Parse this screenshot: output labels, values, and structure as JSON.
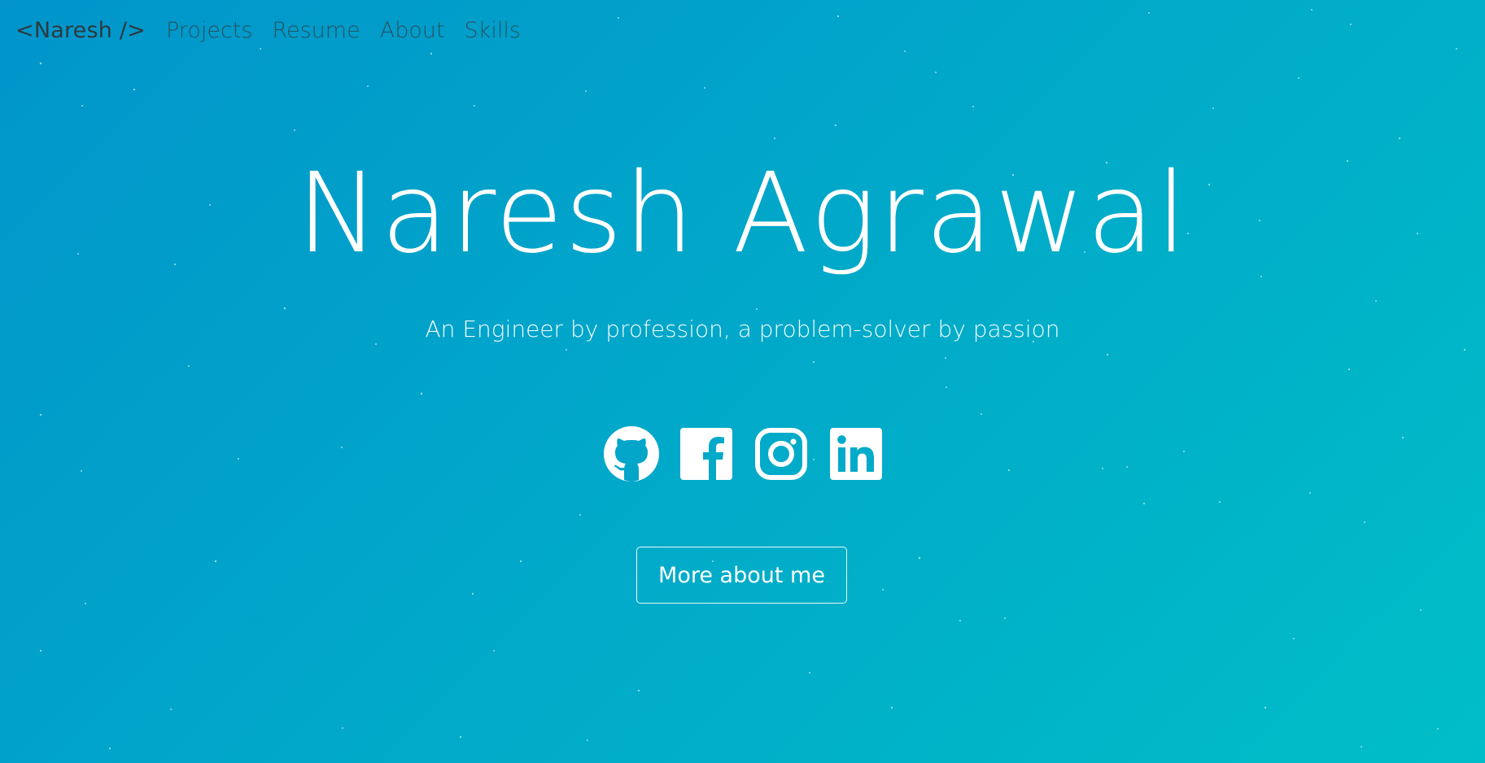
{
  "nav": {
    "brand": "<Naresh />",
    "links": [
      "Projects",
      "Resume",
      "About",
      "Skills"
    ]
  },
  "hero": {
    "title": "Naresh Agrawal",
    "subtitle": "An Engineer by profession, a problem-solver by passion",
    "cta_label": "More about me"
  },
  "socials": [
    {
      "icon": "github-icon"
    },
    {
      "icon": "facebook-icon"
    },
    {
      "icon": "instagram-icon"
    },
    {
      "icon": "linkedin-icon"
    }
  ],
  "colors": {
    "gradient_start": "#0195cb",
    "gradient_end": "#00bec7",
    "text": "#ffffff",
    "nav_text": "#2d3a40"
  }
}
